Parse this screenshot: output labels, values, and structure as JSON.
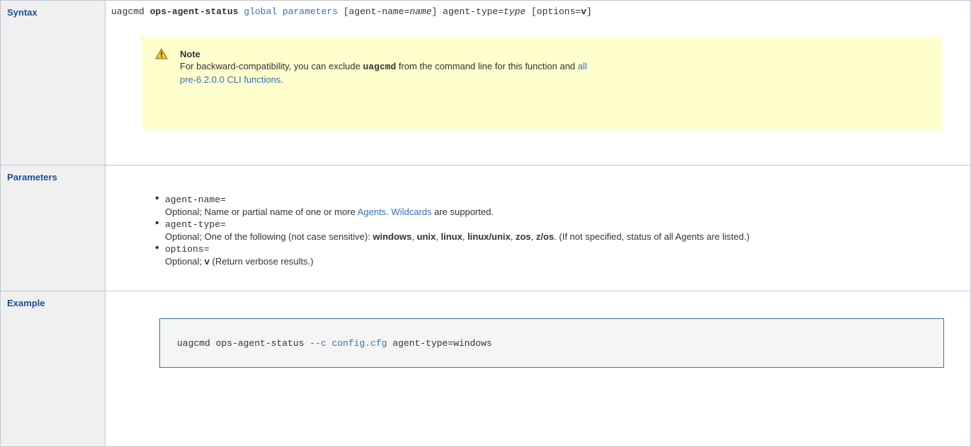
{
  "syntax": {
    "header": "Syntax",
    "cmd": "uagcmd",
    "func": "ops-agent-status",
    "global": "global parameters",
    "p1a": "[agent-name=",
    "p1b": "name",
    "p1c": "] agent-type=",
    "p1d": "type",
    "p1e": " [options=",
    "p1f": "v",
    "p1g": "]",
    "note": {
      "icon": "warning-icon",
      "title": "Note",
      "text_a": "For backward-compatibility, you can exclude ",
      "text_b": "uagcmd",
      "text_c": " from the command line for this function and ",
      "link1": "all",
      "link2": "pre-6.2.0.0 CLI functions",
      "text_d": "."
    }
  },
  "parameters": {
    "header": "Parameters",
    "items": [
      {
        "name": "agent-name=",
        "d1": "Optional; Name or partial name of one or more ",
        "link_a": "Agents",
        "d2": ". ",
        "link_b": "Wildcards",
        "d3": " are supported."
      },
      {
        "name": "agent-type=",
        "d1": "Optional; One of the following (not case sensitive): ",
        "o1": "windows",
        "o2": "unix",
        "o3": "linux",
        "o4": "linux/unix",
        "o5": "zos",
        "o6": "z/os",
        "d2": ". (If not specified, status of all Agents are listed.)"
      },
      {
        "name": "options=",
        "d1": "Optional; ",
        "o1": "v",
        "d2": " (Return verbose results.)"
      }
    ]
  },
  "example": {
    "header": "Example",
    "c1": "uagcmd ops-agent-status ",
    "c2": "--c config.cfg",
    "c3": " agent-type=windows"
  }
}
